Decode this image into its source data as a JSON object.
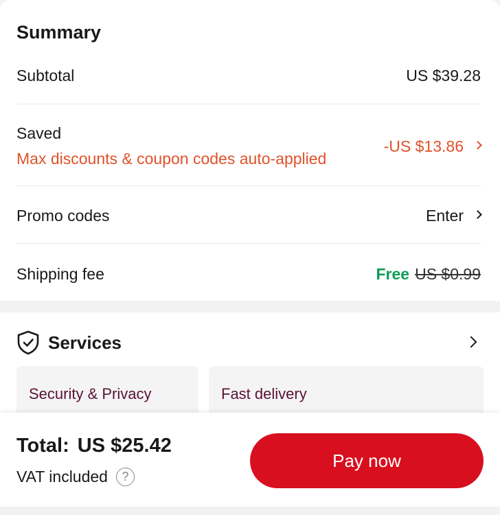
{
  "summary": {
    "title": "Summary",
    "subtotal": {
      "label": "Subtotal",
      "value": "US $39.28"
    },
    "saved": {
      "label": "Saved",
      "sublabel": "Max discounts & coupon codes auto-applied",
      "value": "-US $13.86"
    },
    "promo": {
      "label": "Promo codes",
      "value": "Enter"
    },
    "shipping": {
      "label": "Shipping fee",
      "free": "Free",
      "original": "US $0.99"
    }
  },
  "services": {
    "title": "Services",
    "icon": "shield-check-icon",
    "tiles": [
      {
        "label": "Security & Privacy"
      },
      {
        "label": "Fast delivery"
      }
    ]
  },
  "checkout": {
    "total_label": "Total:",
    "total_value": "US $25.42",
    "vat_label": "VAT included",
    "pay_label": "Pay now"
  },
  "colors": {
    "accent_red": "#d80f1f",
    "discount_orange": "#e0522a",
    "free_green": "#0b9e55",
    "tile_text": "#5a1236"
  }
}
